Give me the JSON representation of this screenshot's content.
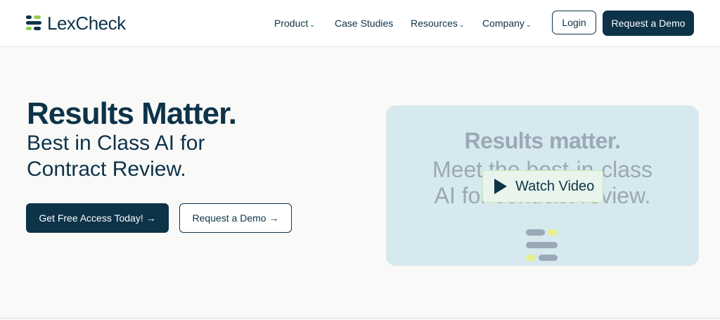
{
  "header": {
    "logo_text": "LexCheck",
    "nav": [
      {
        "label": "Product",
        "dropdown": true
      },
      {
        "label": "Case Studies",
        "dropdown": false
      },
      {
        "label": "Resources",
        "dropdown": true
      },
      {
        "label": "Company",
        "dropdown": true
      }
    ],
    "login_label": "Login",
    "demo_label": "Request a Demo"
  },
  "hero": {
    "title": "Results Matter.",
    "subtitle": "Best in Class AI for Contract Review.",
    "cta_primary": "Get Free Access Today! →",
    "cta_secondary": "Request a Demo →"
  },
  "video": {
    "line1": "Results matter.",
    "line2": "Meet the best-in-class",
    "line3": "AI for contract review.",
    "watch_label": "Watch Video"
  },
  "colors": {
    "brand_navy": "#0d3349",
    "accent_green": "#8fd14f",
    "video_bg": "#d6e9ee"
  }
}
